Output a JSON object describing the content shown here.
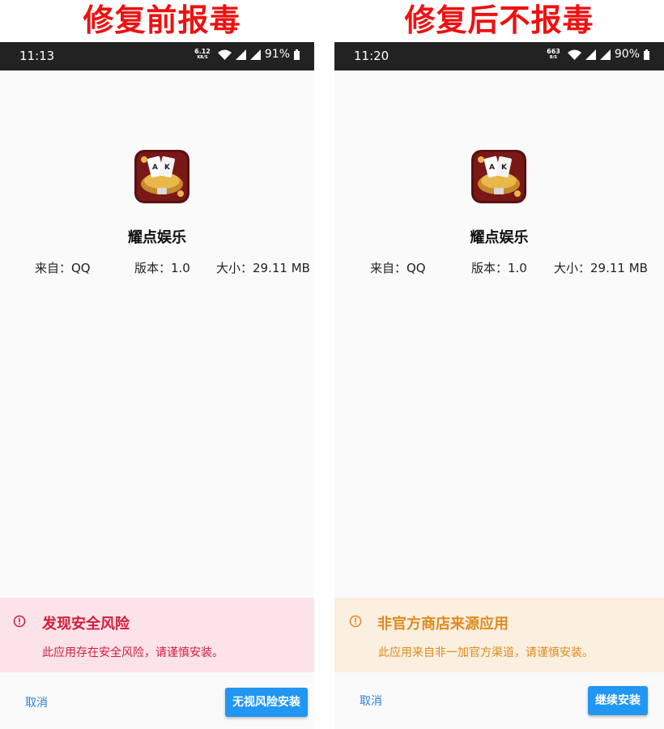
{
  "left": {
    "heading": "修复前报毒",
    "status": {
      "time": "11:13",
      "speed_value": "6.12",
      "speed_unit": "KB/S",
      "battery": "91%"
    },
    "app": {
      "name": "耀点娱乐",
      "source": "来自：QQ",
      "version": "版本：1.0",
      "size": "大小：29.11 MB"
    },
    "warning": {
      "title": "发现安全风险",
      "text": "此应用存在安全风险，请谨慎安装。",
      "color": "#d41c3c",
      "background": "#fbe3e9"
    },
    "buttons": {
      "cancel": "取消",
      "install": "无视风险安装"
    }
  },
  "right": {
    "heading": "修复后不报毒",
    "status": {
      "time": "11:20",
      "speed_value": "663",
      "speed_unit": "B/S",
      "battery": "90%"
    },
    "app": {
      "name": "耀点娱乐",
      "source": "来自：QQ",
      "version": "版本：1.0",
      "size": "大小：29.11 MB"
    },
    "warning": {
      "title": "非官方商店来源应用",
      "text": "此应用来自非一加官方渠道，请谨慎安装。",
      "color": "#e08a1e",
      "background": "#fbefe0"
    },
    "buttons": {
      "cancel": "取消",
      "install": "继续安装"
    }
  },
  "colors": {
    "heading": "#ee1111",
    "accent": "#2196f3",
    "status_bar": "#222222"
  }
}
